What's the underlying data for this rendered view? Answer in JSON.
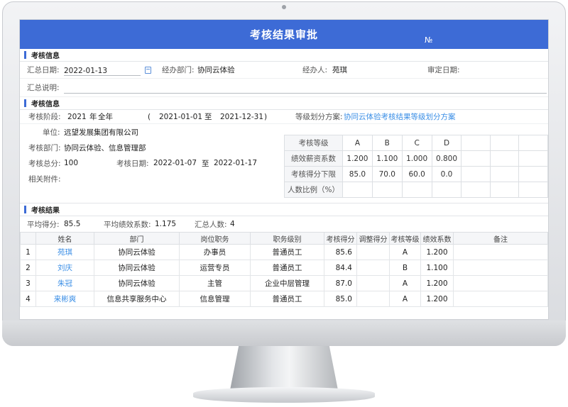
{
  "page": {
    "title": "考核结果审批",
    "no_label": "№"
  },
  "section1": {
    "heading": "考核信息",
    "summary_date_label": "汇总日期:",
    "summary_date_value": "2022-01-13",
    "dept_label": "经办部门:",
    "dept_value": "协同云体验",
    "handler_label": "经办人:",
    "handler_value": "苑琪",
    "approve_date_label": "审定日期:",
    "note_label": "汇总说明:"
  },
  "section2": {
    "heading": "考核信息",
    "stage_label": "考核阶段:",
    "stage_year": "2021",
    "stage_year_unit": "年",
    "stage_period": "全年",
    "paren_open": "(",
    "range_start": "2021-01-01",
    "range_to": "至",
    "range_end": "2021-12-31",
    "paren_close": ")",
    "scheme_label": "等级划分方案:",
    "scheme_value": "协同云体验考核结果等级划分方案",
    "unit_label": "单位:",
    "unit_value": "远望发展集团有限公司",
    "dept_label": "考核部门:",
    "dept_value": "协同云体验、信息管理部",
    "total_label": "考核总分:",
    "total_value": "100",
    "date_label": "考核日期:",
    "date_start": "2022-01-07",
    "date_to": "至",
    "date_end": "2022-01-17",
    "attach_label": "相关附件:",
    "grade_table": {
      "rows": [
        {
          "head": "考核等级",
          "cells": [
            "A",
            "B",
            "C",
            "D"
          ]
        },
        {
          "head": "绩效薪资系数",
          "cells": [
            "1.200",
            "1.100",
            "1.000",
            "0.800"
          ]
        },
        {
          "head": "考核得分下限",
          "cells": [
            "85.0",
            "70.0",
            "60.0",
            "0.0"
          ]
        },
        {
          "head": "人数比例（%）",
          "cells": [
            "",
            "",
            "",
            ""
          ]
        }
      ]
    }
  },
  "section3": {
    "heading": "考核结果",
    "avg_score_label": "平均得分:",
    "avg_score_value": "85.5",
    "avg_coef_label": "平均绩效系数:",
    "avg_coef_value": "1.175",
    "count_label": "汇总人数:",
    "count_value": "4",
    "columns": [
      "",
      "姓名",
      "部门",
      "岗位职务",
      "职务级别",
      "考核得分",
      "调整得分",
      "考核等级",
      "绩效系数",
      "备注"
    ],
    "rows": [
      {
        "idx": "1",
        "name": "苑琪",
        "dept": "协同云体验",
        "post": "办事员",
        "level": "普通员工",
        "score": "85.6",
        "adj": "",
        "grade": "A",
        "coef": "1.200",
        "note": ""
      },
      {
        "idx": "2",
        "name": "刘庆",
        "dept": "协同云体验",
        "post": "运营专员",
        "level": "普通员工",
        "score": "84.4",
        "adj": "",
        "grade": "B",
        "coef": "1.100",
        "note": ""
      },
      {
        "idx": "3",
        "name": "朱冠",
        "dept": "协同云体验",
        "post": "主管",
        "level": "企业中层管理",
        "score": "87.0",
        "adj": "",
        "grade": "A",
        "coef": "1.200",
        "note": ""
      },
      {
        "idx": "4",
        "name": "来彬爽",
        "dept": "信息共享服务中心",
        "post": "信息管理",
        "level": "普通员工",
        "score": "85.0",
        "adj": "",
        "grade": "A",
        "coef": "1.200",
        "note": ""
      }
    ]
  }
}
